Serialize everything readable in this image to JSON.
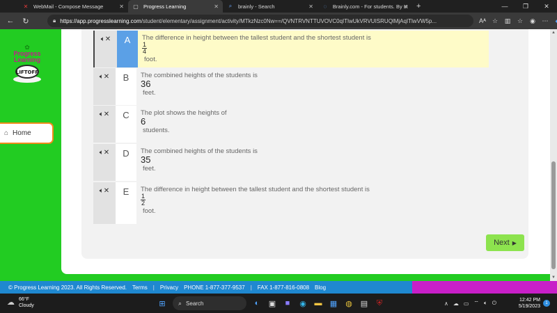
{
  "browser": {
    "tabs": [
      {
        "label": "WebMail - Compose Message",
        "icon": "x-mail-icon",
        "active": false
      },
      {
        "label": "Progress Learning",
        "icon": "page-icon",
        "active": true
      },
      {
        "label": "brainly - Search",
        "icon": "search-icon",
        "active": false
      },
      {
        "label": "Brainly.com - For students. By stu",
        "icon": "loading-icon",
        "active": false
      }
    ],
    "new_tab": "+",
    "url_host": "https://app.progresslearning.com",
    "url_path": "/student/elementary/assignment/activity/MTkzNzc0Nw==/QVNTRVNTTUVOVC0qITlwUkVRVUISRUQlMjAqITlwVW5p...",
    "reader_icon": "Aᴬ"
  },
  "sidebar": {
    "logo_line1": "Progress",
    "logo_line2": "Learning",
    "liftoff_text": "LIFTOFF",
    "home_label": "Home"
  },
  "options": [
    {
      "letter": "A",
      "text": "The difference in height between the tallest student and the shortest student is",
      "value_type": "fraction",
      "num": "1",
      "den": "4",
      "unit": "foot.",
      "selected": true
    },
    {
      "letter": "B",
      "text": "The combined heights of the students is",
      "value_type": "number",
      "value": "36",
      "unit": "feet.",
      "selected": false
    },
    {
      "letter": "C",
      "text": "The plot shows the heights of",
      "value_type": "number",
      "value": "6",
      "unit": "students.",
      "selected": false
    },
    {
      "letter": "D",
      "text": "The combined heights of the students is",
      "value_type": "number",
      "value": "35",
      "unit": "feet.",
      "selected": false
    },
    {
      "letter": "E",
      "text": "The difference in height between the tallest student and the shortest student is",
      "value_type": "fraction",
      "num": "1",
      "den": "2",
      "unit": "foot.",
      "selected": false
    }
  ],
  "next_label": "Next",
  "footer": {
    "copyright": "© Progress Learning 2023. All Rights Reserved.",
    "terms": "Terms",
    "privacy": "Privacy",
    "phone": "PHONE 1-877-377-9537",
    "fax": "FAX 1-877-816-0808",
    "blog": "Blog",
    "separator": "|"
  },
  "taskbar": {
    "temperature": "66°F",
    "condition": "Cloudy",
    "search_label": "Search",
    "time": "12:42 PM",
    "date": "5/19/2023",
    "notifications": "1"
  },
  "colors": {
    "page_green": "#22cc22",
    "selected_letter_bg": "#5ba0e6",
    "selected_body_bg": "#fefbc8",
    "next_button": "#8de34e",
    "footer_blue": "#1f88d0",
    "footer_magenta": "#c81fc8"
  }
}
